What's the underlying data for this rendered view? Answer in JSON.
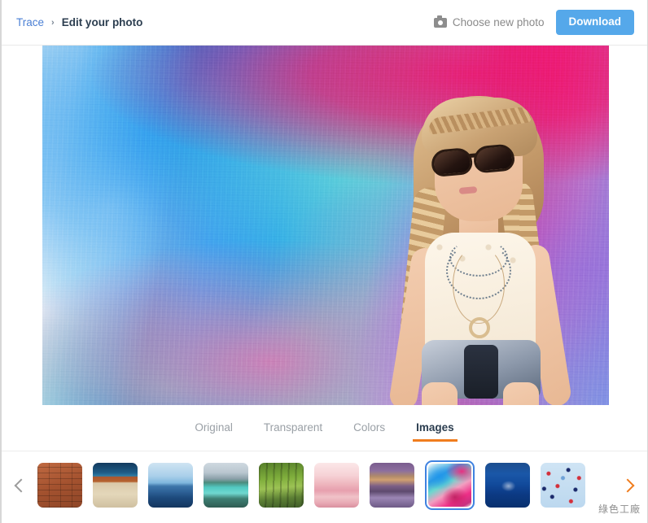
{
  "header": {
    "breadcrumb": {
      "root": "Trace",
      "separator": "›",
      "current": "Edit your photo"
    },
    "choose_photo_label": "Choose new photo",
    "choose_photo_icon": "camera-icon",
    "download_label": "Download",
    "download_color": "#55a8ea"
  },
  "photo": {
    "alt": "Woman with sunglasses and braided hair in front of a multicolored painted wall",
    "background_description": "abstract painted canvas in blue, teal, pink and magenta"
  },
  "tabs": {
    "items": [
      {
        "label": "Original",
        "active": false
      },
      {
        "label": "Transparent",
        "active": false
      },
      {
        "label": "Colors",
        "active": false
      },
      {
        "label": "Images",
        "active": true
      }
    ],
    "active_underline_color": "#f07d1e"
  },
  "strip": {
    "prev_icon": "chevron-left-icon",
    "next_icon": "chevron-right-icon",
    "prev_color": "#9b9b9b",
    "next_color": "#f07d1e",
    "selected_index": 7,
    "selected_border_color": "#3f82e0",
    "thumbnails": [
      {
        "name": "brick-wall",
        "class": "t-brick"
      },
      {
        "name": "desert-beach",
        "class": "t-beach"
      },
      {
        "name": "blue-mountains",
        "class": "t-bluemtn"
      },
      {
        "name": "mountain-lake",
        "class": "t-lake"
      },
      {
        "name": "green-forest",
        "class": "t-forest"
      },
      {
        "name": "pink-waves",
        "class": "t-pink"
      },
      {
        "name": "venice-canal",
        "class": "t-venice"
      },
      {
        "name": "colorful-paint",
        "class": "t-paint"
      },
      {
        "name": "deep-sea",
        "class": "t-deepsea"
      },
      {
        "name": "confetti-pattern",
        "class": "t-confetti"
      }
    ]
  },
  "watermark": {
    "text": "綠色工廠"
  }
}
